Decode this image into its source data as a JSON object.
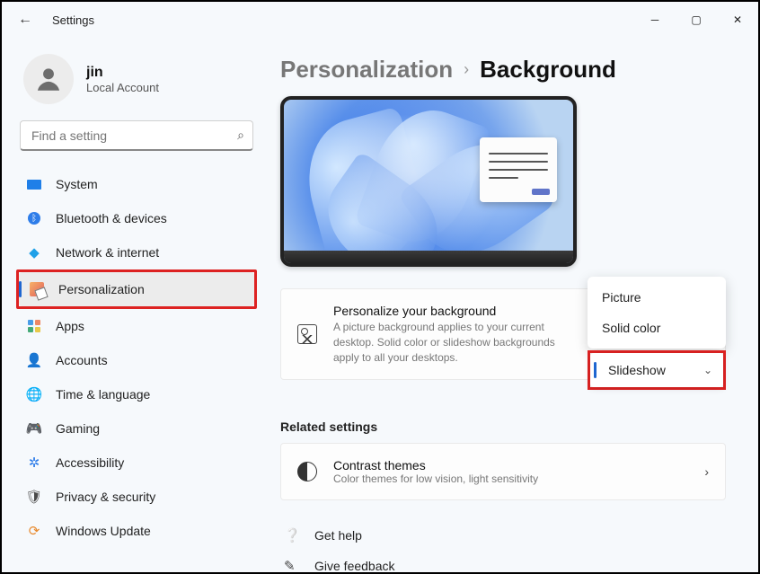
{
  "window": {
    "title": "Settings"
  },
  "profile": {
    "name": "jin",
    "account_type": "Local Account"
  },
  "search": {
    "placeholder": "Find a setting"
  },
  "sidebar": {
    "items": [
      {
        "label": "System"
      },
      {
        "label": "Bluetooth & devices"
      },
      {
        "label": "Network & internet"
      },
      {
        "label": "Personalization"
      },
      {
        "label": "Apps"
      },
      {
        "label": "Accounts"
      },
      {
        "label": "Time & language"
      },
      {
        "label": "Gaming"
      },
      {
        "label": "Accessibility"
      },
      {
        "label": "Privacy & security"
      },
      {
        "label": "Windows Update"
      }
    ],
    "selected_index": 3
  },
  "breadcrumb": {
    "parent": "Personalization",
    "current": "Background"
  },
  "background_card": {
    "title": "Personalize your background",
    "description": "A picture background applies to your current desktop. Solid color or slideshow backgrounds apply to all your desktops."
  },
  "bg_dropdown": {
    "options": [
      "Picture",
      "Solid color",
      "Slideshow"
    ],
    "selected": "Slideshow"
  },
  "related": {
    "heading": "Related settings",
    "contrast": {
      "title": "Contrast themes",
      "desc": "Color themes for low vision, light sensitivity"
    }
  },
  "links": {
    "help": "Get help",
    "feedback": "Give feedback"
  }
}
